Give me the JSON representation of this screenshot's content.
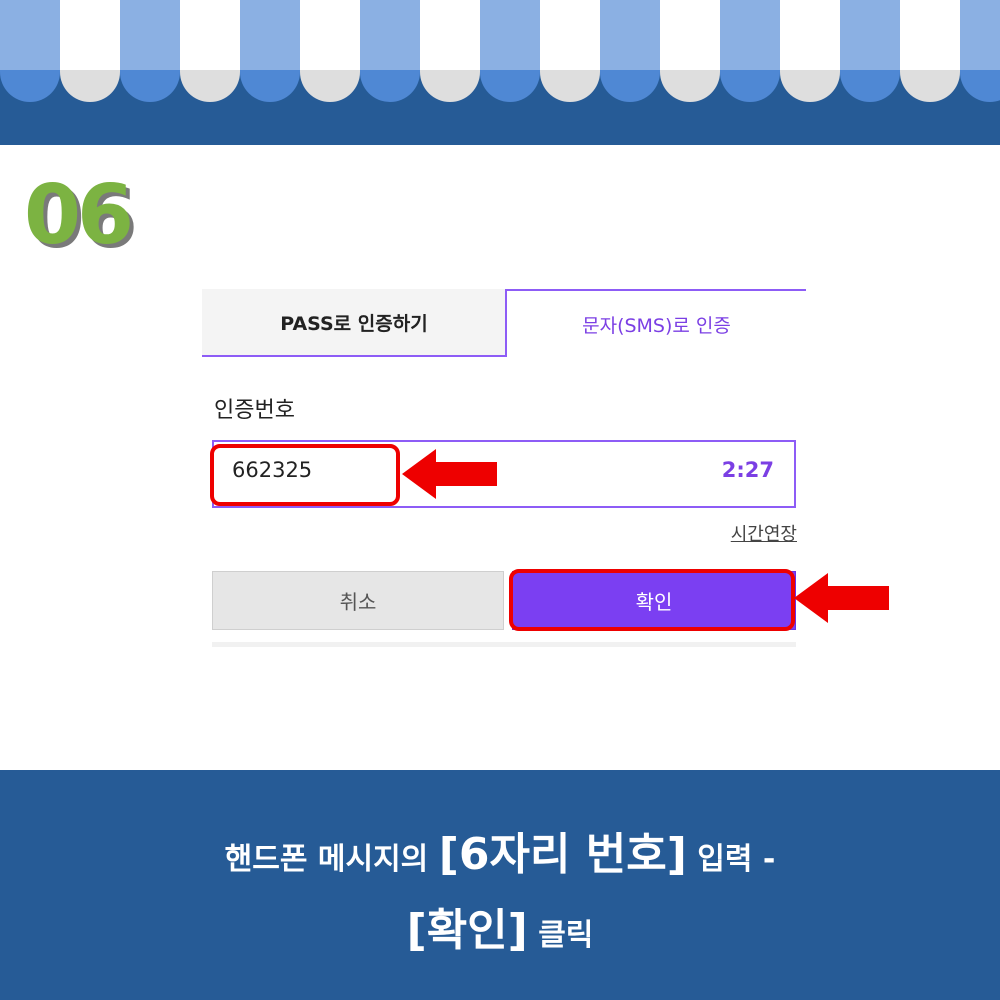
{
  "step": {
    "number": "06"
  },
  "tabs": [
    {
      "label": "PASS로 인증하기",
      "selected": false
    },
    {
      "label": "문자(SMS)로 인증",
      "selected": true
    }
  ],
  "form": {
    "code_label": "인증번호",
    "code_value": "662325",
    "timer": "2:27",
    "extend_label": "시간연장",
    "cancel_label": "취소",
    "confirm_label": "확인"
  },
  "caption": {
    "line1_prefix": "핸드폰 메시지의 ",
    "line1_emphasis": "[6자리 번호]",
    "line1_suffix": " 입력 -",
    "line2_emphasis": "[확인]",
    "line2_suffix": " 클릭"
  },
  "colors": {
    "header_navy": "#265b96",
    "awning_blue": "#8bb0e3",
    "step_green": "#7cb342",
    "accent_purple": "#7b3ff2",
    "highlight_red": "#ee0000"
  },
  "icons": {
    "pointer_arrow": "left-pointing-arrow-icon"
  }
}
